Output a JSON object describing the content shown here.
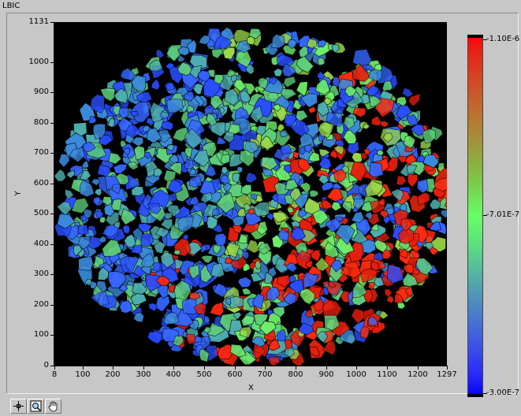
{
  "panel": {
    "title": "LBIC"
  },
  "chart_data": {
    "type": "heatmap",
    "title": "",
    "xlabel": "X",
    "ylabel": "Y",
    "xlim": [
      8,
      1297
    ],
    "ylim": [
      0,
      1131
    ],
    "x_ticks": [
      "8",
      "100",
      "200",
      "300",
      "400",
      "500",
      "600",
      "700",
      "800",
      "900",
      "1000",
      "1100",
      "1200",
      "1297"
    ],
    "y_ticks": [
      "0",
      "100",
      "200",
      "300",
      "400",
      "500",
      "600",
      "700",
      "800",
      "900",
      "1000",
      "1131"
    ],
    "colorbar": {
      "max_label": "-1.10E-6",
      "mid_label": "-7.01E-7",
      "min_label": "-3.00E-7",
      "max_value": -1.1e-06,
      "mid_value": -7.01e-07,
      "min_value": -3e-07,
      "colormap": [
        "#ff0000",
        "#66ff66",
        "#0000ff"
      ]
    },
    "background_color": "#000000"
  },
  "toolbar": {
    "tools": [
      {
        "name": "cursor-move-tool"
      },
      {
        "name": "zoom-tool"
      },
      {
        "name": "pan-hand-tool"
      }
    ]
  }
}
